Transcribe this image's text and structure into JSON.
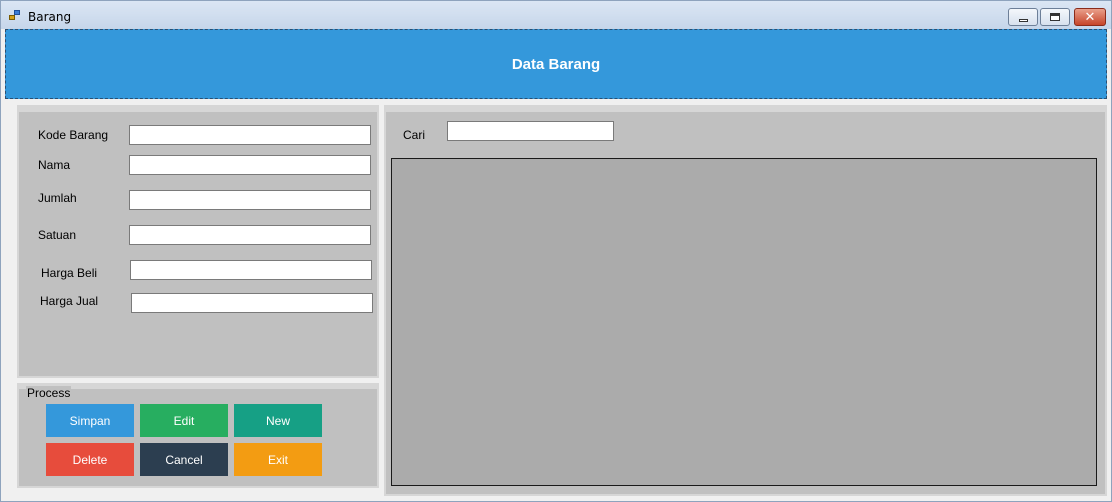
{
  "window": {
    "title": "Barang",
    "icon": "app-window-icon",
    "controls": {
      "minimize": "minimize-icon",
      "maximize": "maximize-icon",
      "close": "close-icon"
    }
  },
  "header": {
    "title": "Data Barang",
    "color": "#3498db"
  },
  "form": {
    "fields": [
      {
        "label": "Kode Barang",
        "value": ""
      },
      {
        "label": "Nama",
        "value": ""
      },
      {
        "label": "Jumlah",
        "value": ""
      },
      {
        "label": "Satuan",
        "value": ""
      },
      {
        "label": "Harga Beli",
        "value": ""
      },
      {
        "label": "Harga Jual",
        "value": ""
      }
    ]
  },
  "process": {
    "label": "Process",
    "buttons": [
      {
        "label": "Simpan",
        "color": "#3498db"
      },
      {
        "label": "Edit",
        "color": "#27ae60"
      },
      {
        "label": "New",
        "color": "#16a085"
      },
      {
        "label": "Delete",
        "color": "#e74c3c"
      },
      {
        "label": "Cancel",
        "color": "#2c3e50"
      },
      {
        "label": "Exit",
        "color": "#f39c12"
      }
    ]
  },
  "search": {
    "label": "Cari",
    "value": ""
  }
}
